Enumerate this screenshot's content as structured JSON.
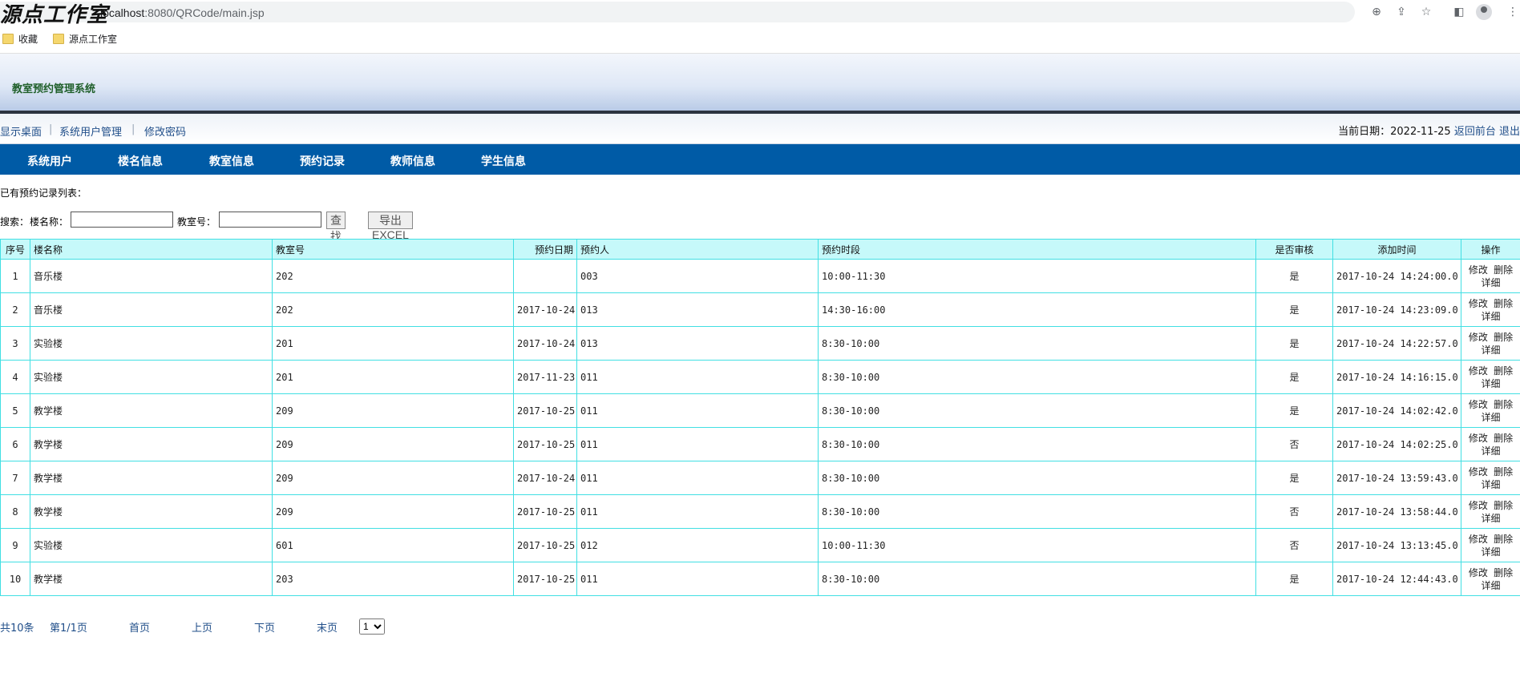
{
  "browser": {
    "watermark": "源点工作室",
    "url_host": "localhost",
    "url_rest": ":8080/QRCode/main.jsp",
    "bookmarks": [
      "收藏",
      "源点工作室"
    ],
    "icons": [
      "zoom-icon",
      "share-icon",
      "star-icon",
      "sidebar-icon",
      "profile-icon",
      "more-icon"
    ]
  },
  "app": {
    "title": "教室预约管理系统",
    "subnav": [
      "显示桌面",
      "系统用户管理",
      "修改密码"
    ],
    "date_label": "当前日期：2022-11-25",
    "back_link": "返回前台",
    "logout_link": "退出",
    "nav": [
      "系统用户",
      "楼名信息",
      "教室信息",
      "预约记录",
      "教师信息",
      "学生信息"
    ],
    "accent_color": "#005ba6",
    "table_border_color": "#41dfe3",
    "table_header_bg": "#c6f9fa"
  },
  "content": {
    "list_title": "已有预约记录列表：",
    "search": {
      "prefix": "搜索：",
      "building_label": "楼名称：",
      "building_value": "",
      "room_label": "教室号：",
      "room_value": "",
      "find_button": "查找",
      "export_button": "导出EXCEL"
    },
    "table": {
      "headers": [
        "序号",
        "楼名称",
        "教室号",
        "预约日期",
        "预约人",
        "预约时段",
        "是否审核",
        "添加时间",
        "操作"
      ],
      "rows": [
        {
          "no": "1",
          "building": "音乐楼",
          "room": "202",
          "date": "",
          "person": "003",
          "slot": "10:00-11:30",
          "approved": "是",
          "added": "2017-10-24 14:24:00.0"
        },
        {
          "no": "2",
          "building": "音乐楼",
          "room": "202",
          "date": "2017-10-24",
          "person": "013",
          "slot": "14:30-16:00",
          "approved": "是",
          "added": "2017-10-24 14:23:09.0"
        },
        {
          "no": "3",
          "building": "实验楼",
          "room": "201",
          "date": "2017-10-24",
          "person": "013",
          "slot": "8:30-10:00",
          "approved": "是",
          "added": "2017-10-24 14:22:57.0"
        },
        {
          "no": "4",
          "building": "实验楼",
          "room": "201",
          "date": "2017-11-23",
          "person": "011",
          "slot": "8:30-10:00",
          "approved": "是",
          "added": "2017-10-24 14:16:15.0"
        },
        {
          "no": "5",
          "building": "教学楼",
          "room": "209",
          "date": "2017-10-25",
          "person": "011",
          "slot": "8:30-10:00",
          "approved": "是",
          "added": "2017-10-24 14:02:42.0"
        },
        {
          "no": "6",
          "building": "教学楼",
          "room": "209",
          "date": "2017-10-25",
          "person": "011",
          "slot": "8:30-10:00",
          "approved": "否",
          "added": "2017-10-24 14:02:25.0"
        },
        {
          "no": "7",
          "building": "教学楼",
          "room": "209",
          "date": "2017-10-24",
          "person": "011",
          "slot": "8:30-10:00",
          "approved": "是",
          "added": "2017-10-24 13:59:43.0"
        },
        {
          "no": "8",
          "building": "教学楼",
          "room": "209",
          "date": "2017-10-25",
          "person": "011",
          "slot": "8:30-10:00",
          "approved": "否",
          "added": "2017-10-24 13:58:44.0"
        },
        {
          "no": "9",
          "building": "实验楼",
          "room": "601",
          "date": "2017-10-25",
          "person": "012",
          "slot": "10:00-11:30",
          "approved": "否",
          "added": "2017-10-24 13:13:45.0"
        },
        {
          "no": "10",
          "building": "教学楼",
          "room": "203",
          "date": "2017-10-25",
          "person": "011",
          "slot": "8:30-10:00",
          "approved": "是",
          "added": "2017-10-24 12:44:43.0"
        }
      ],
      "actions": {
        "edit": "修改",
        "delete": "删除",
        "detail": "详细"
      }
    },
    "pager": {
      "total": "共10条",
      "page": "第1/1页",
      "first": "首页",
      "prev": "上页",
      "next": "下页",
      "last": "末页",
      "selected": "1"
    }
  }
}
